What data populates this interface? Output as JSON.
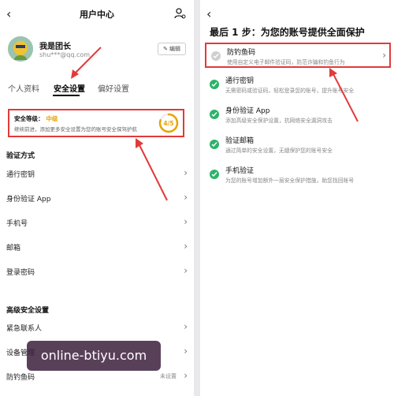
{
  "left": {
    "header": {
      "title": "用户中心"
    },
    "profile": {
      "name": "我是团长",
      "email": "shu***@qq.com",
      "edit_label": "编辑"
    },
    "tabs": [
      {
        "label": "个人资料",
        "active": false
      },
      {
        "label": "安全设置",
        "active": true
      },
      {
        "label": "偏好设置",
        "active": false
      }
    ],
    "security": {
      "level_label": "安全等级：",
      "level_value": "中级",
      "desc": "继续前进，添加更多安全设置为您的账号安全保驾护航",
      "score": "4/5",
      "score_fraction": 0.8
    },
    "verify_section": {
      "title": "验证方式",
      "items": [
        {
          "label": "通行密钥",
          "value": ""
        },
        {
          "label": "身份验证 App",
          "value": ""
        },
        {
          "label": "手机号",
          "value": ""
        },
        {
          "label": "邮箱",
          "value": ""
        },
        {
          "label": "登录密码",
          "value": ""
        }
      ]
    },
    "advanced_section": {
      "title": "高级安全设置",
      "items": [
        {
          "label": "紧急联系人",
          "value": ""
        },
        {
          "label": "设备管理",
          "value": ""
        },
        {
          "label": "防钓鱼码",
          "value": "未设置"
        }
      ]
    },
    "watermark": "online-btiyu.com"
  },
  "right": {
    "title": "最后 1 步：为您的账号提供全面保护",
    "items": [
      {
        "title": "防钓鱼码",
        "desc": "使用自定义电子邮件验证码，防范诈骗和钓鱼行为",
        "status": "grey",
        "chevron": true
      },
      {
        "title": "通行密钥",
        "desc": "无需密码或验证码，轻松登录您的账号，提升账号安全",
        "status": "green",
        "chevron": false
      },
      {
        "title": "身份验证 App",
        "desc": "添加高级安全保护设置，抗网络安全漏洞攻击",
        "status": "green",
        "chevron": false
      },
      {
        "title": "验证邮箱",
        "desc": "通过简单的安全设置，无缝保护您的账号安全",
        "status": "green",
        "chevron": false
      },
      {
        "title": "手机验证",
        "desc": "为您的账号增加额外一层安全保护措施，助您找回账号",
        "status": "green",
        "chevron": false
      }
    ]
  },
  "colors": {
    "highlight_red": "#e23a3a",
    "level_orange": "#e8a400",
    "check_green": "#2bb36a"
  }
}
